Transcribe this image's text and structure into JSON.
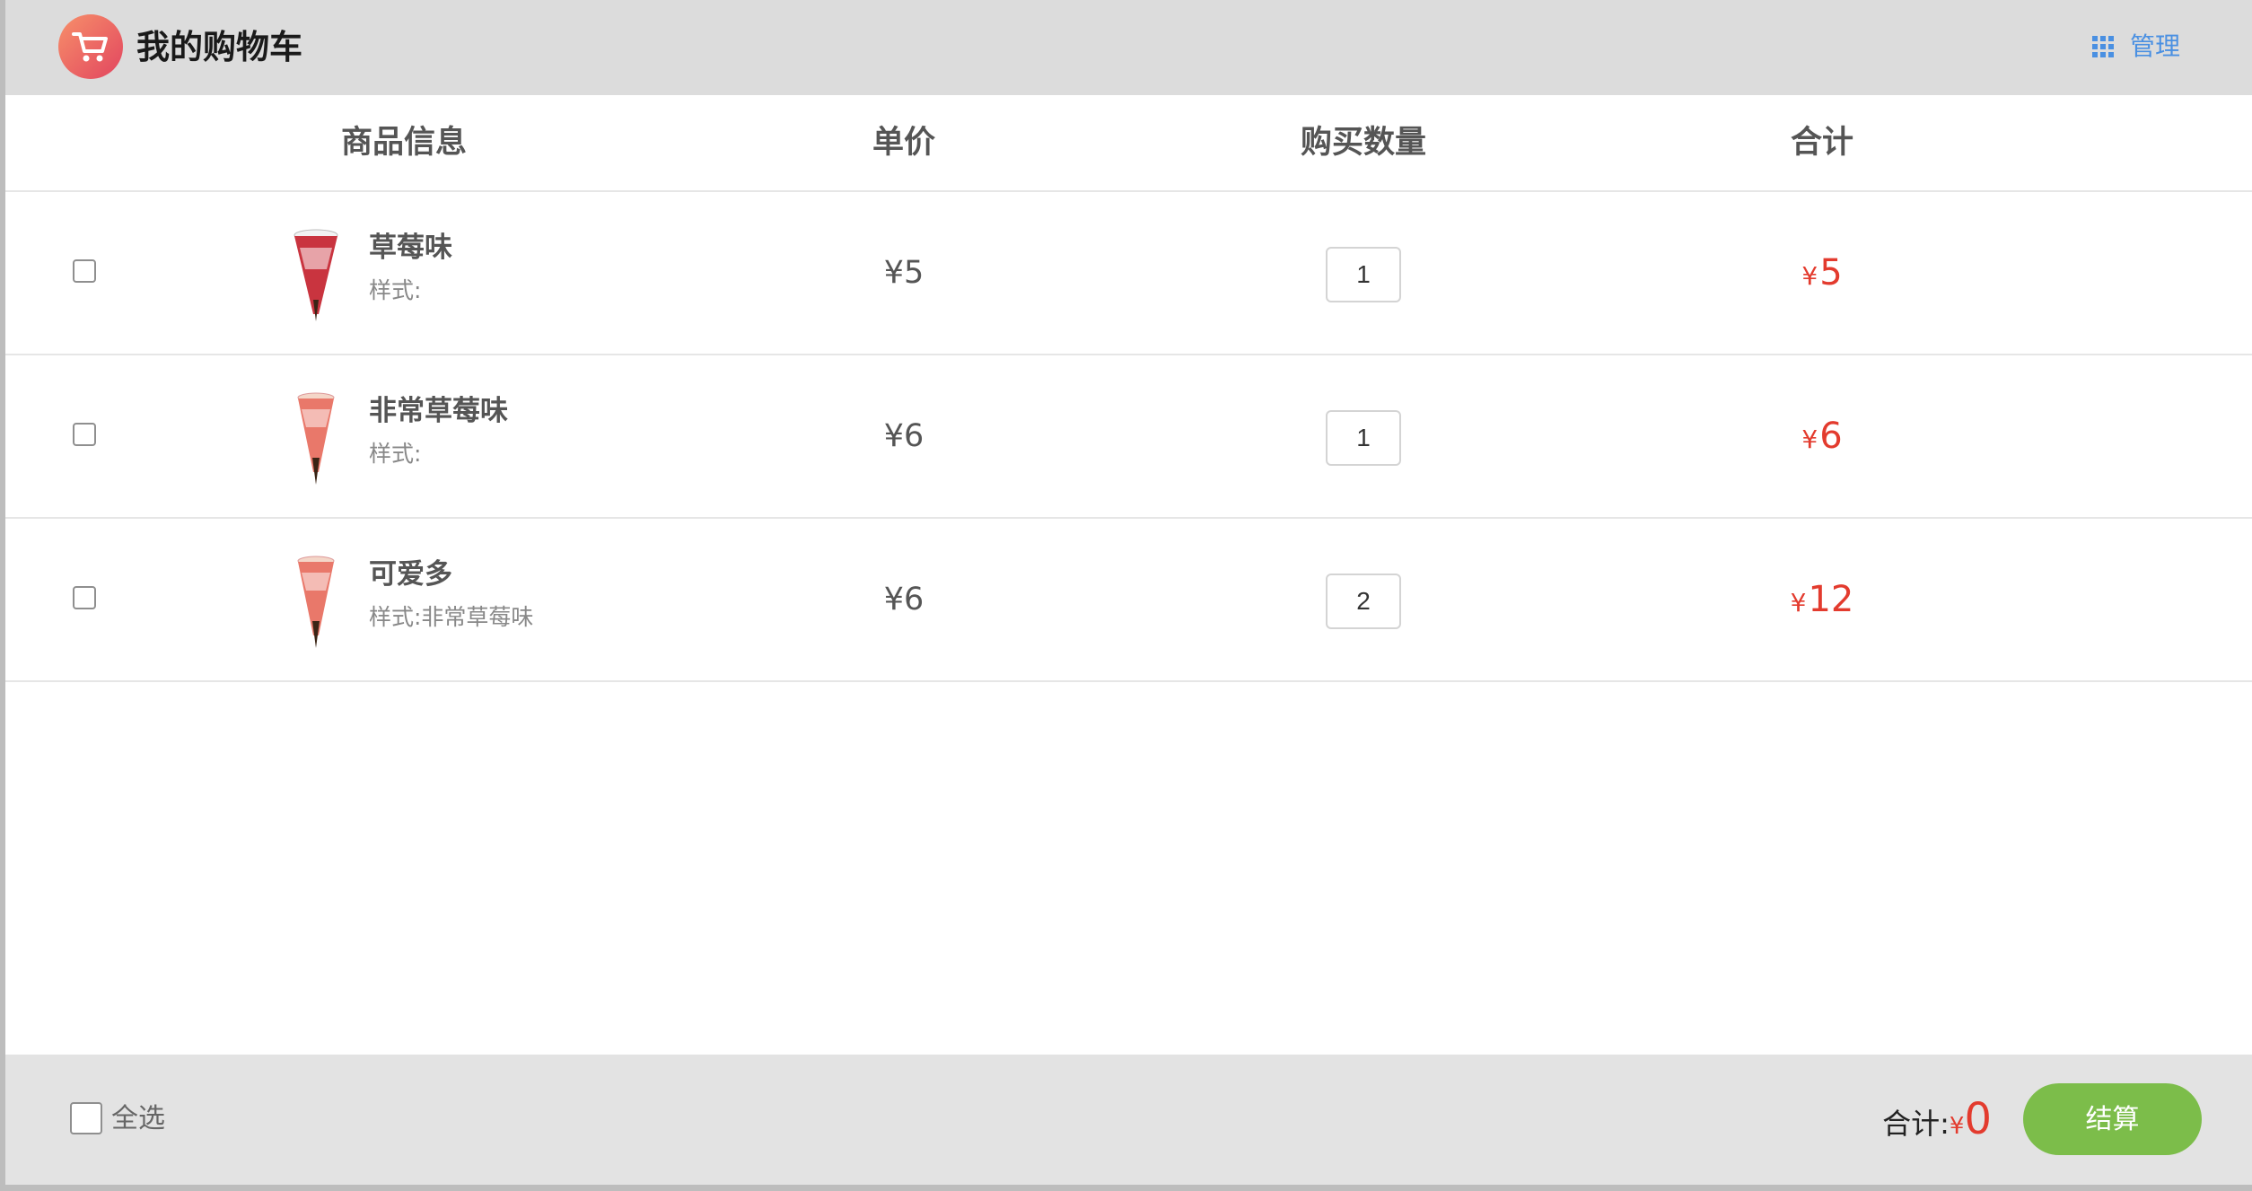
{
  "header": {
    "title": "我的购物车",
    "manage_label": "管理",
    "logo_icon": "shopping-cart-icon",
    "manage_icon": "grid-icon",
    "accent": "#4a90e2"
  },
  "columns": {
    "product": "商品信息",
    "unit_price": "单价",
    "quantity": "购买数量",
    "total": "合计"
  },
  "items": [
    {
      "name": "草莓味",
      "spec": "样式:",
      "price": "¥5",
      "quantity": "1",
      "subtotal_currency": "¥",
      "subtotal_amount": "5",
      "checked": false,
      "thumb_color": "#c9343f"
    },
    {
      "name": "非常草莓味",
      "spec": "样式:",
      "price": "¥6",
      "quantity": "1",
      "subtotal_currency": "¥",
      "subtotal_amount": "6",
      "checked": false,
      "thumb_color": "#e9786a"
    },
    {
      "name": "可爱多",
      "spec": "样式:非常草莓味",
      "price": "¥6",
      "quantity": "2",
      "subtotal_currency": "¥",
      "subtotal_amount": "12",
      "checked": false,
      "thumb_color": "#e9786a"
    }
  ],
  "footer": {
    "select_all_label": "全选",
    "total_label": "合计:",
    "total_currency": "¥",
    "total_amount": "0",
    "checkout_label": "结算",
    "checkout_color": "#7cbd4a",
    "price_color": "#e33b2e"
  }
}
